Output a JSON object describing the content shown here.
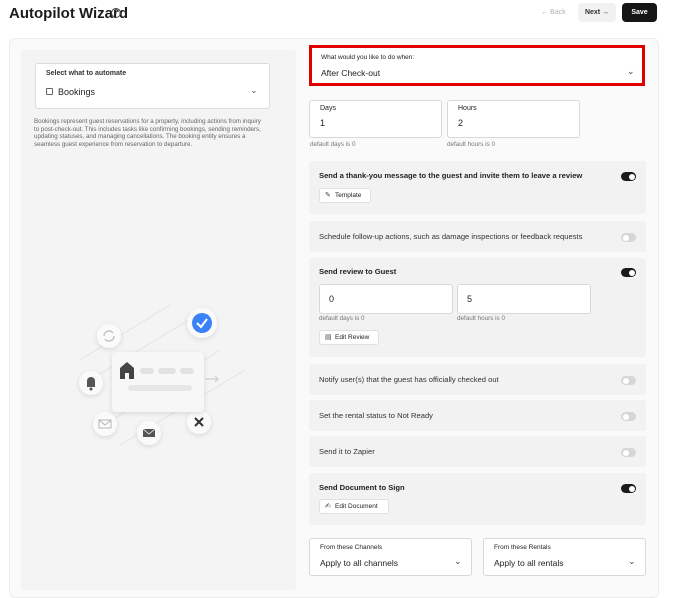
{
  "header": {
    "title": "Autopilot Wizard",
    "help_icon": "?",
    "back_label": "← Back",
    "next_label": "Next →",
    "save_label": "Save"
  },
  "left": {
    "select_label": "Select what to automate",
    "select_value": "Bookings",
    "description": "Bookings represent guest reservations for a property, including actions from inquiry to post-check-out. This includes tasks like confirming bookings, sending reminders, updating statuses, and managing cancellations. The booking entity ensures a seamless guest experience from reservation to departure."
  },
  "trigger": {
    "label": "What would you like to do when:",
    "value": "After Check-out"
  },
  "timing": {
    "days_label": "Days",
    "days_value": "1",
    "days_hint": "default days is 0",
    "hours_label": "Hours",
    "hours_value": "2",
    "hours_hint": "default hours is 0"
  },
  "actions": [
    {
      "label": "Send a thank-you message to the guest and invite them to leave a review",
      "enabled": true,
      "button": "Template"
    },
    {
      "label": "Schedule follow-up actions, such as damage inspections or feedback requests",
      "enabled": false
    },
    {
      "label": "Send review to Guest",
      "enabled": true,
      "days_value": "0",
      "days_hint": "default days is 0",
      "hours_value": "5",
      "hours_hint": "default hours is 0",
      "button": "Edit Review"
    },
    {
      "label": "Notify user(s) that the guest has officially checked out",
      "enabled": false
    },
    {
      "label": "Set the rental status to Not Ready",
      "enabled": false
    },
    {
      "label": "Send it to Zapier",
      "enabled": false
    },
    {
      "label": "Send Document to Sign",
      "enabled": true,
      "button": "Edit Document"
    }
  ],
  "filters": {
    "channels_label": "From these Channels",
    "channels_value": "Apply to all channels",
    "rentals_label": "From these Rentals",
    "rentals_value": "Apply to all rentals"
  },
  "colors": {
    "highlight": "#e00000",
    "toggle_on": "#1a1a1a",
    "toggle_off": "#d6d6d6",
    "accent_blue": "#3b82f6"
  }
}
